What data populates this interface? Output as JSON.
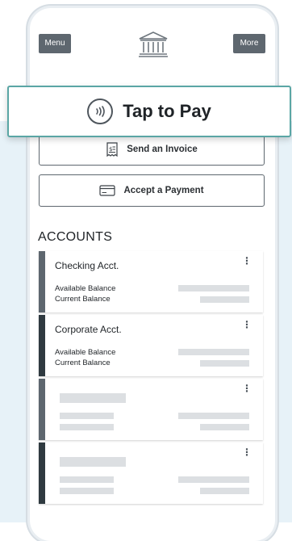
{
  "header": {
    "menu_label": "Menu",
    "more_label": "More",
    "logo": "bank-building-icon"
  },
  "tap_to_pay": {
    "label": "Tap to Pay",
    "icon": "contactless-icon"
  },
  "actions": [
    {
      "label": "Send an Invoice",
      "icon": "invoice-icon"
    },
    {
      "label": "Accept a Payment",
      "icon": "card-icon"
    }
  ],
  "accounts": {
    "title": "ACCOUNTS",
    "items": [
      {
        "name": "Checking Acct.",
        "available_label": "Available Balance",
        "current_label": "Current Balance",
        "accent": "#5e676f"
      },
      {
        "name": "Corporate Acct.",
        "available_label": "Available Balance",
        "current_label": "Current Balance",
        "accent": "#2f3a40"
      },
      {
        "name": "",
        "available_label": "",
        "current_label": "",
        "accent": "#5e676f"
      },
      {
        "name": "",
        "available_label": "",
        "current_label": "",
        "accent": "#2f3a40"
      }
    ]
  },
  "colors": {
    "brand_gray": "#5e676f",
    "tap_border": "#5aa6a5",
    "background": "#e7f2f8"
  }
}
